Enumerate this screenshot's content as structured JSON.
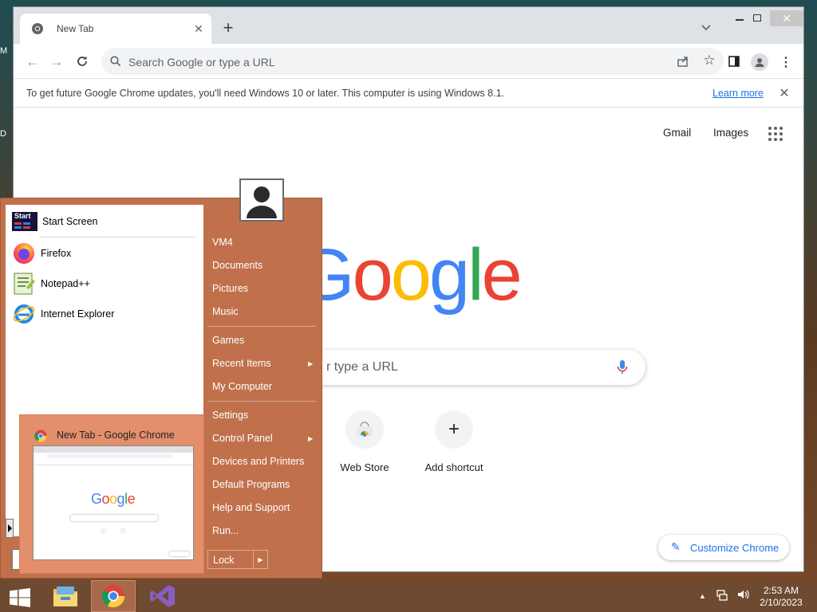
{
  "desktop": {
    "edge_labels": [
      "M",
      "D"
    ]
  },
  "browser": {
    "tab_title": "New Tab",
    "window_title": "New Tab - Google Chrome",
    "omnibox_placeholder": "Search Google or type a URL",
    "infobar": {
      "message": "To get future Google Chrome updates, you'll need Windows 10 or later. This computer is using Windows 8.1.",
      "link": "Learn more"
    },
    "ntp": {
      "gmail": "Gmail",
      "images": "Images",
      "logo": "Google",
      "search_placeholder_visible": "r type a URL",
      "shortcuts": [
        {
          "label": "Web Store"
        },
        {
          "label": "Add shortcut"
        }
      ],
      "customize": "Customize Chrome"
    }
  },
  "start_menu": {
    "pinned": [
      {
        "label": "Start Screen",
        "icon": "start-screen-icon"
      },
      {
        "label": "Firefox",
        "icon": "firefox-icon"
      },
      {
        "label": "Notepad++",
        "icon": "notepadpp-icon"
      },
      {
        "label": "Internet Explorer",
        "icon": "ie-icon"
      }
    ],
    "right_items": [
      {
        "label": "VM4"
      },
      {
        "label": "Documents"
      },
      {
        "label": "Pictures"
      },
      {
        "label": "Music"
      },
      {
        "label": "Games"
      },
      {
        "label": "Recent Items",
        "submenu": true
      },
      {
        "label": "My Computer"
      },
      {
        "label": "Settings"
      },
      {
        "label": "Control Panel",
        "submenu": true
      },
      {
        "label": "Devices and Printers"
      },
      {
        "label": "Default Programs"
      },
      {
        "label": "Help and Support"
      },
      {
        "label": "Run..."
      }
    ],
    "lock_label": "Lock",
    "start_icon_text": "Start"
  },
  "thumbnail": {
    "title": "New Tab - Google Chrome",
    "logo": "Google"
  },
  "taskbar": {
    "apps": [
      "file-explorer-icon",
      "chrome-icon",
      "visual-studio-icon"
    ],
    "clock": {
      "time": "2:53 AM",
      "date": "2/10/2023"
    }
  },
  "colors": {
    "start_menu_bg": "#c0714c",
    "taskbar_bg": "#6e4a30",
    "google_blue": "#4285f4",
    "google_red": "#ea4335",
    "google_yellow": "#fbbc05",
    "google_green": "#34a853",
    "link_blue": "#1a73e8"
  }
}
